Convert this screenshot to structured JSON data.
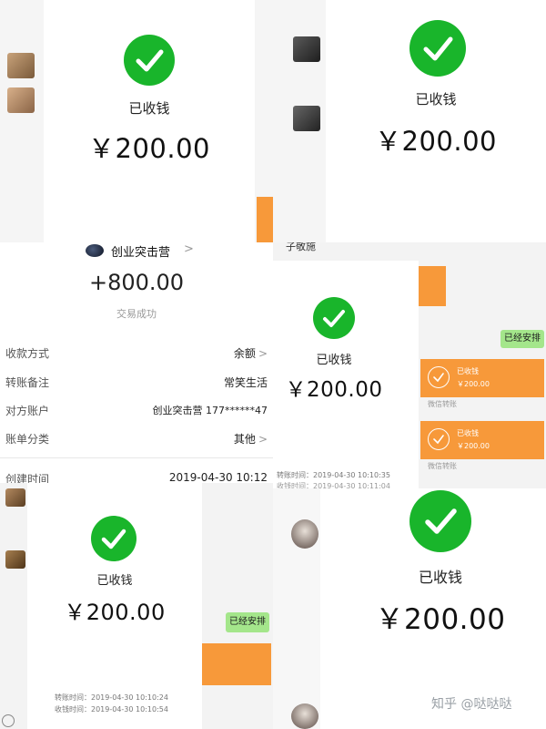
{
  "received": {
    "label": "已收钱",
    "amount": "￥200.00"
  },
  "middle_panel": {
    "merchant_name": "创业突击营",
    "merchant_chevron": ">",
    "total": "+800.00",
    "status": "交易成功",
    "rows": [
      {
        "label": "收款方式",
        "value": "余额",
        "chevron": ">"
      },
      {
        "label": "转账备注",
        "value": "常笑生活",
        "chevron": ""
      },
      {
        "label": "对方账户",
        "value": "创业突击营 177******47",
        "chevron": ""
      },
      {
        "label": "账单分类",
        "value": "其他",
        "chevron": ">"
      }
    ],
    "created_label": "创建时间",
    "created_value": "2019-04-30 10:12"
  },
  "chat_right_mid": {
    "top_text": "子敬施",
    "bubble": "已经安排",
    "cards": [
      {
        "title": "已收钱",
        "amount": "￥200.00",
        "footer": "微信转账"
      },
      {
        "title": "已收钱",
        "amount": "￥200.00",
        "footer": "微信转账"
      }
    ],
    "transfer_time": "转账时间：2019-04-30 10:10:35",
    "receive_time": "收钱时间：2019-04-30 10:11:04"
  },
  "chat_bottom_left": {
    "bubble": "已经安排",
    "transfer_time": "转账时间：2019-04-30 10:10:24",
    "receive_time": "收钱时间：2019-04-30 10:10:54"
  },
  "watermark": "知乎 @哒哒哒",
  "icons": [
    "check-icon",
    "chevron-right-icon",
    "back-arrow-icon"
  ],
  "colors": {
    "success_green": "#19b52b",
    "transfer_orange": "#f7993a",
    "chat_green": "#a4e68b"
  }
}
